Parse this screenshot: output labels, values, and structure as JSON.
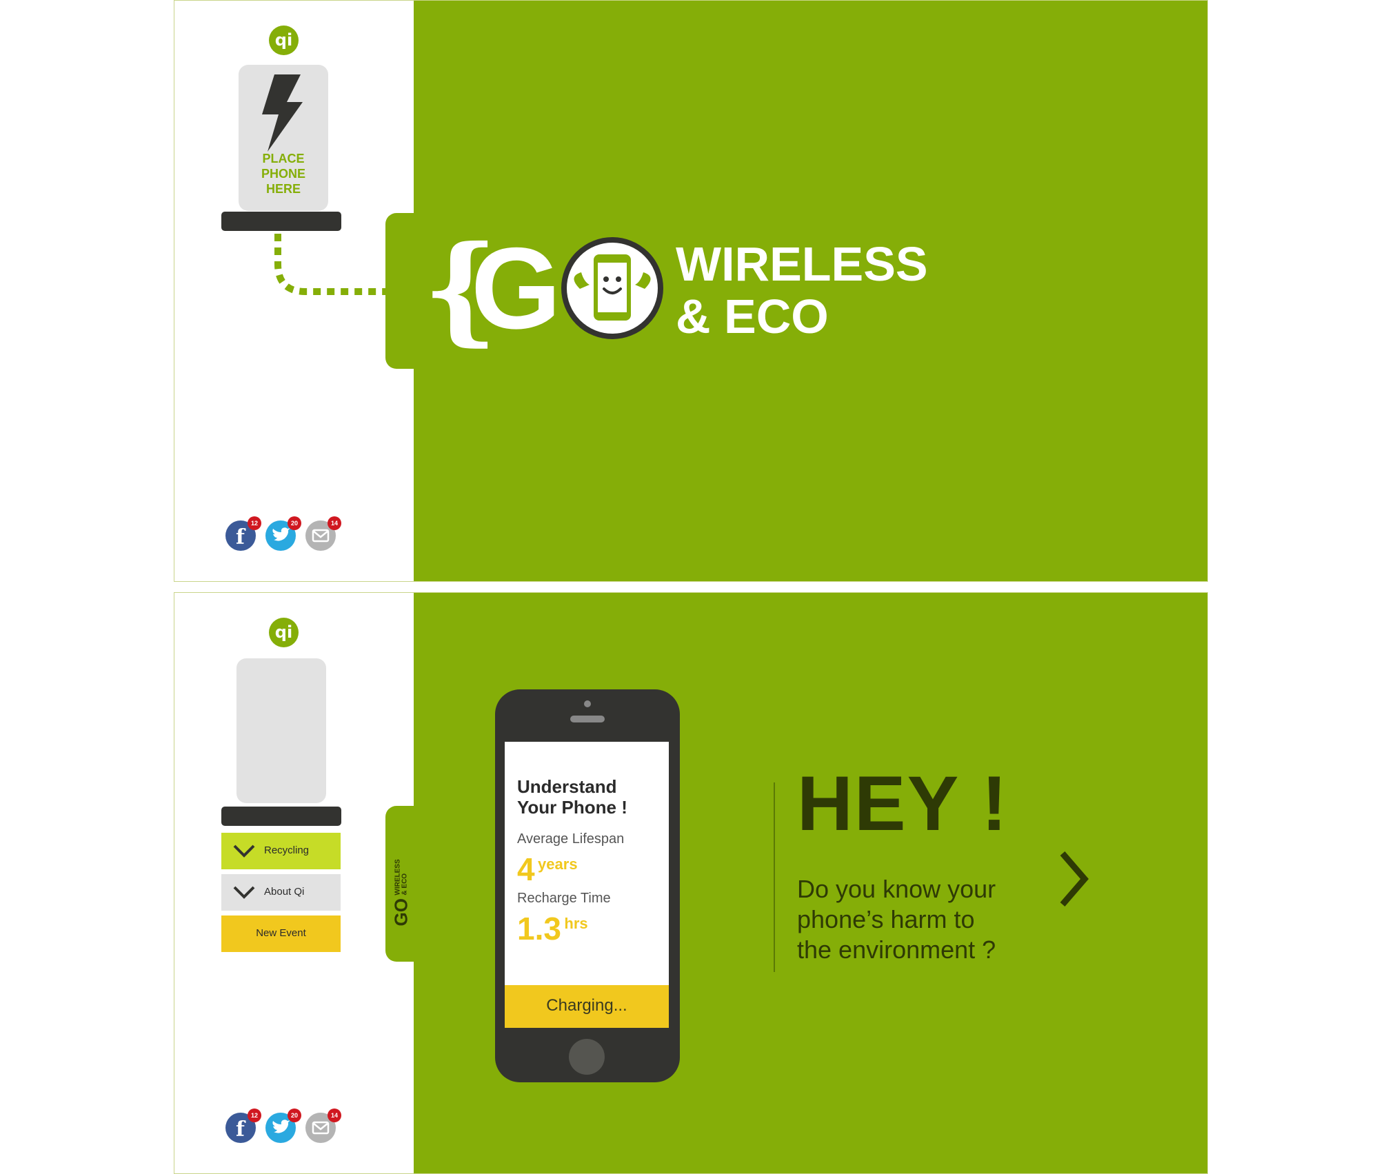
{
  "colors": {
    "brand_green": "#85ae08",
    "dark": "#333330",
    "yellow": "#f1c81e",
    "lime": "#c6dc27",
    "badge_red": "#d01820"
  },
  "screen1": {
    "qi_logo": "qi",
    "pad_label": "PLACE\nPHONE\nHERE",
    "brace": "{",
    "go": "GO",
    "wireless": "WIRELESS",
    "eco": "& ECO",
    "social": [
      {
        "name": "facebook-icon",
        "glyph": "f",
        "count": "12"
      },
      {
        "name": "twitter-icon",
        "glyph": "",
        "count": "20"
      },
      {
        "name": "mail-icon",
        "glyph": "",
        "count": "14"
      }
    ]
  },
  "screen2": {
    "qi_logo": "qi",
    "menu": [
      {
        "label": "Recycling"
      },
      {
        "label": "About Qi"
      },
      {
        "label": "New Event"
      }
    ],
    "tab_go": "GO",
    "tab_sub": "WIRELESS\n& ECO",
    "phone": {
      "title": "Understand\nYour Phone !",
      "lifespan_label": "Average Lifespan",
      "lifespan_value": "4",
      "lifespan_unit": "years",
      "recharge_label": "Recharge Time",
      "recharge_value": "1.3",
      "recharge_unit": "hrs",
      "charging": "Charging..."
    },
    "hey": "HEY !",
    "question": "Do you know your\nphone’s harm to\nthe environment ?",
    "social": [
      {
        "name": "facebook-icon",
        "count": "12"
      },
      {
        "name": "twitter-icon",
        "count": "20"
      },
      {
        "name": "mail-icon",
        "count": "14"
      }
    ]
  }
}
